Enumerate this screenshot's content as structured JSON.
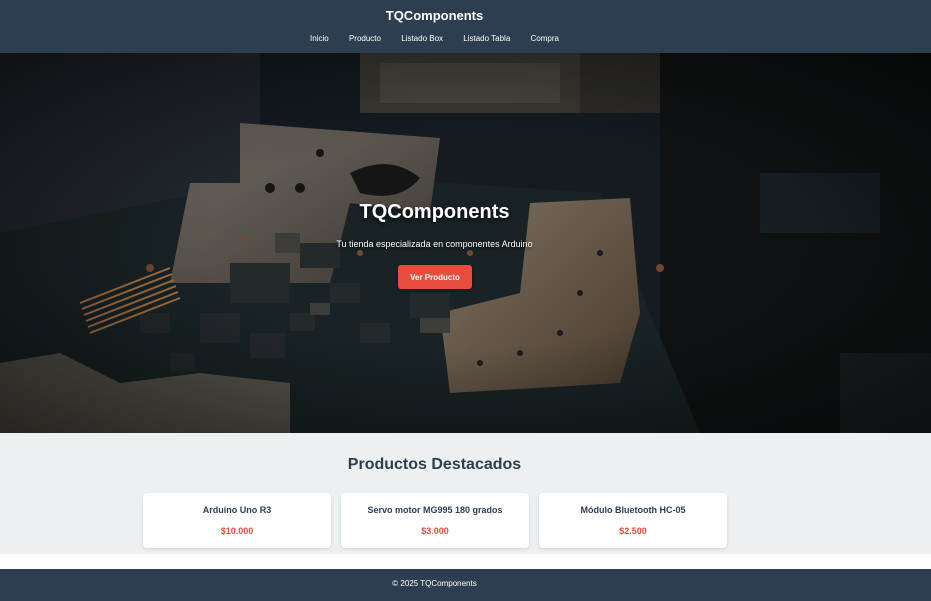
{
  "header": {
    "brand": "TQComponents",
    "nav": [
      "Inicio",
      "Producto",
      "Listado Box",
      "Listado Tabla",
      "Compra"
    ]
  },
  "hero": {
    "title": "TQComponents",
    "subtitle": "Tu tienda especializada en componentes Arduino",
    "button": "Ver Producto",
    "background_icon": "circuit-board-photo"
  },
  "featured": {
    "title": "Productos Destacados",
    "products": [
      {
        "name": "Arduino Uno R3",
        "price": "$10.000"
      },
      {
        "name": "Servo motor MG995 180 grados",
        "price": "$3.000"
      },
      {
        "name": "Módulo Bluetooth HC-05",
        "price": "$2.500"
      }
    ]
  },
  "footer": {
    "text": "© 2025 TQComponents"
  },
  "colors": {
    "primary": "#2c3e50",
    "accent": "#e74c3c",
    "section_bg": "#ecf0f1"
  }
}
